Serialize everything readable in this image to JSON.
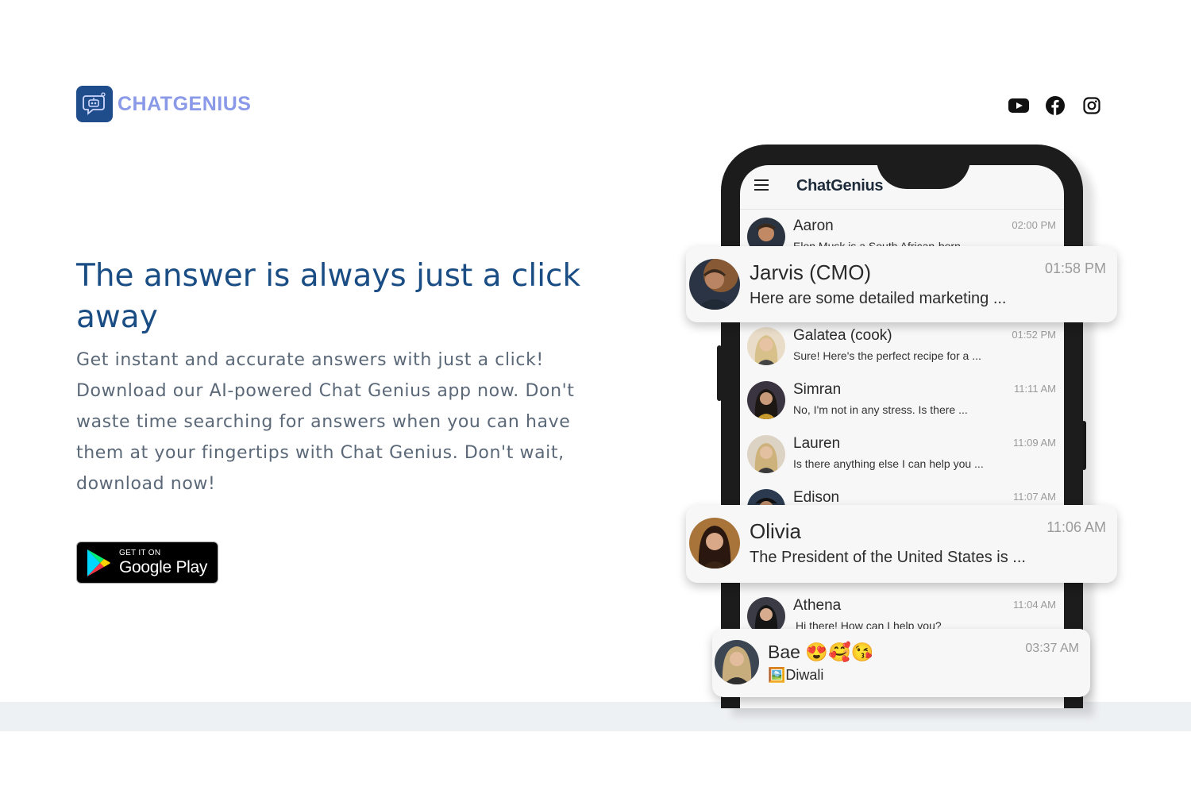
{
  "brand": {
    "name": "CHATGENIUS",
    "logo_icon": "robot-chat-icon"
  },
  "socials": [
    {
      "icon": "youtube-icon"
    },
    {
      "icon": "facebook-icon"
    },
    {
      "icon": "instagram-icon"
    }
  ],
  "hero": {
    "title": "The answer is always just a click away",
    "description": "Get instant and accurate answers with just a click! Download our AI-powered Chat Genius app now. Don't waste time searching for answers when you can have them at your fingertips with Chat Genius. Don't wait, download now!"
  },
  "store_badge": {
    "small": "GET IT ON",
    "big": "Google Play"
  },
  "phone": {
    "app_title": "ChatGenius",
    "chats": [
      {
        "name": "Aaron",
        "message": "Elon Musk is a South African-born",
        "time": "02:00 PM"
      },
      {
        "name": "Galatea (cook)",
        "message": "Sure! Here's the perfect recipe for a ...",
        "time": "01:52 PM"
      },
      {
        "name": "Simran",
        "message": "No, I'm not in any stress. Is there ...",
        "time": "11:11 AM"
      },
      {
        "name": "Lauren",
        "message": "Is there anything else I can help you ...",
        "time": "11:09 AM"
      },
      {
        "name": "Edison",
        "message": "",
        "time": "11:07 AM"
      },
      {
        "name": "Athena",
        "message": "Hi there! How can I help you?",
        "time": "11:04 AM"
      }
    ],
    "highlighted": [
      {
        "name": "Jarvis (CMO)",
        "message": "Here are some detailed marketing ...",
        "time": "01:58 PM"
      },
      {
        "name": "Olivia",
        "message": "The President of the United States is ...",
        "time": "11:06 AM"
      },
      {
        "name": "Bae 😍🥰😘",
        "message": "🖼️Diwali",
        "time": "03:37 AM"
      }
    ]
  },
  "colors": {
    "title": "#1a4d84",
    "brand": "#8b9ae8",
    "logo_bg": "#1f4d8c",
    "body_text": "#5b6878"
  }
}
